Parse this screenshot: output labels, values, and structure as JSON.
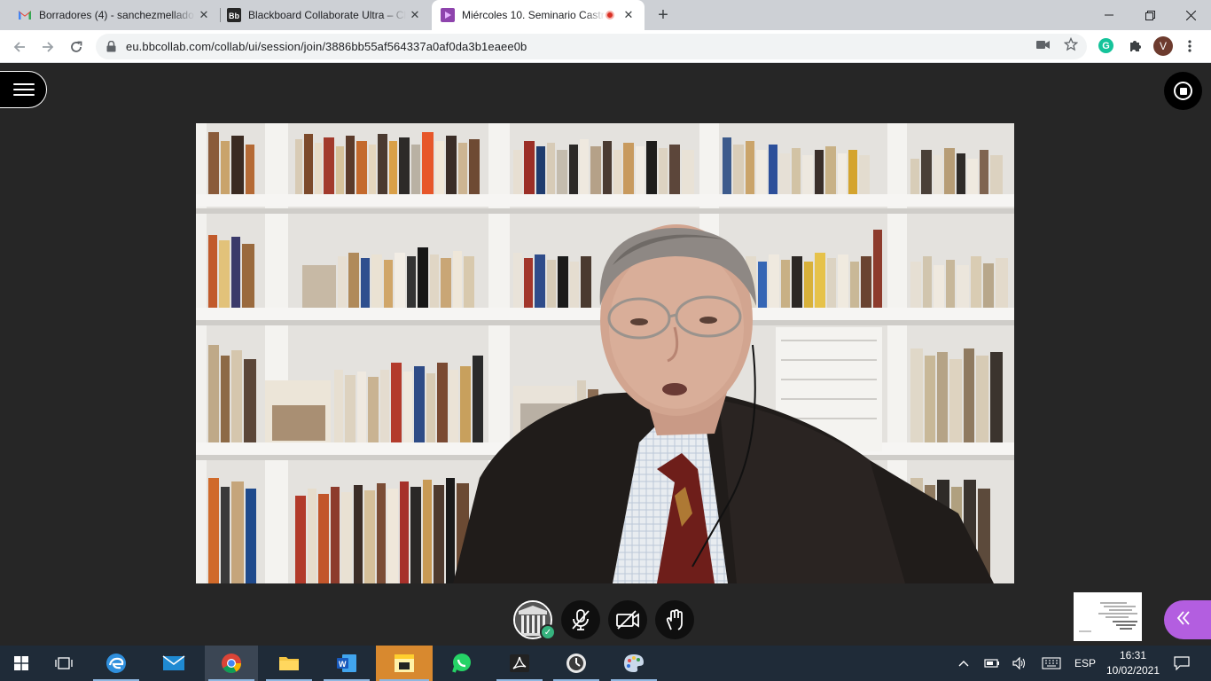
{
  "browser": {
    "tabs": [
      {
        "title": "Borradores (4) - sanchezmellado",
        "icon": "gmail-icon"
      },
      {
        "title": "Blackboard Collaborate Ultra – Cl",
        "icon": "blackboard-icon"
      },
      {
        "title": "Miércoles 10. Seminario Castr",
        "icon": "collaborate-icon",
        "recording": true
      }
    ],
    "address": "eu.bbcollab.com/collab/ui/session/join/3886bb55af564337a0af0da3b1eaee0b",
    "profile_initial": "V",
    "extension_initial": "G"
  },
  "taskbar": {
    "language": "ESP",
    "time": "16:31",
    "date": "10/02/2021"
  }
}
